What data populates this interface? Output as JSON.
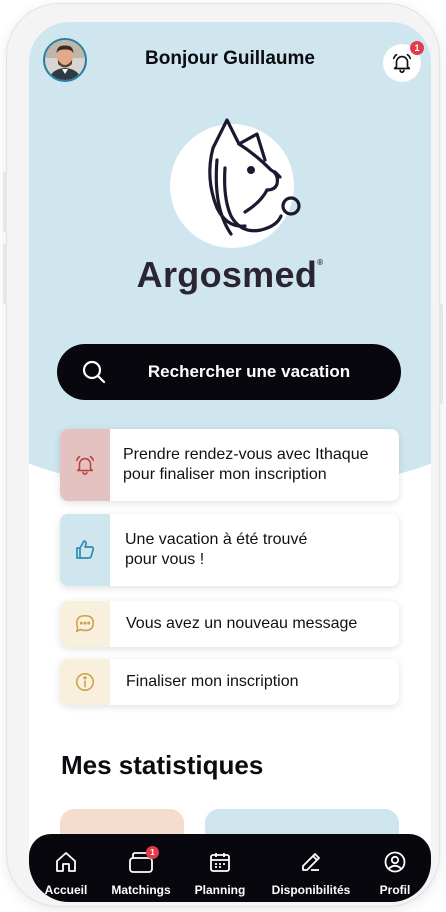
{
  "header": {
    "greeting": "Bonjour Guillaume",
    "notification_count": "1"
  },
  "brand": {
    "name": "Argosmed",
    "trademark": "®"
  },
  "search": {
    "label": "Rechercher une vacation"
  },
  "alerts": [
    {
      "icon": "bell-icon",
      "lines": [
        "Prendre rendez-vous avec Ithaque",
        "pour finaliser mon inscription"
      ],
      "strip_color": "#e4c2c1",
      "icon_color": "#b7423f"
    },
    {
      "icon": "thumbs-up-icon",
      "lines": [
        "Une vacation à été trouvé",
        "pour vous !"
      ],
      "strip_color": "#cfe6ef",
      "icon_color": "#2c8db5"
    },
    {
      "icon": "chat-bubble-icon",
      "lines": [
        "Vous avez un nouveau message"
      ],
      "strip_color": "#f8efdd",
      "icon_color": "#c9a24a"
    },
    {
      "icon": "info-icon",
      "lines": [
        "Finaliser mon inscription"
      ],
      "strip_color": "#f8efdd",
      "icon_color": "#c9a24a"
    }
  ],
  "stats": {
    "title": "Mes statistiques",
    "card_colors": [
      "#f6dccd",
      "#cfe6ef"
    ]
  },
  "tabbar": {
    "items": [
      {
        "label": "Accueil",
        "icon": "home-icon"
      },
      {
        "label": "Matchings",
        "icon": "cards-icon",
        "badge": "1"
      },
      {
        "label": "Planning",
        "icon": "calendar-icon"
      },
      {
        "label": "Disponibilités",
        "icon": "edit-icon"
      },
      {
        "label": "Profil",
        "icon": "profile-icon"
      }
    ]
  },
  "colors": {
    "hero_background": "#cfe6ef",
    "dark": "#07070d",
    "badge": "#e23c4c"
  }
}
